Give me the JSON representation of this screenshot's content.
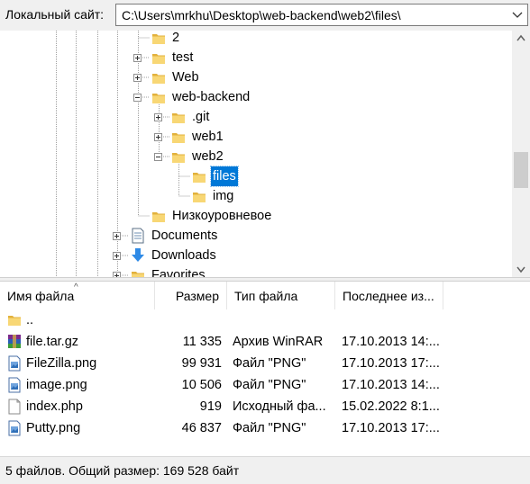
{
  "path_bar": {
    "label": "Локальный сайт:",
    "path": "C:\\Users\\mrkhu\\Desktop\\web-backend\\web2\\files\\"
  },
  "tree": {
    "nodes": [
      {
        "label": "2",
        "icon": "folder-icon",
        "expander": "none"
      },
      {
        "label": "test",
        "icon": "folder-icon",
        "expander": "plus"
      },
      {
        "label": "Web",
        "icon": "folder-icon",
        "expander": "plus"
      },
      {
        "label": "web-backend",
        "icon": "folder-icon",
        "expander": "minus"
      },
      {
        "label": ".git",
        "icon": "folder-icon",
        "expander": "plus"
      },
      {
        "label": "web1",
        "icon": "folder-icon",
        "expander": "plus"
      },
      {
        "label": "web2",
        "icon": "folder-icon",
        "expander": "minus"
      },
      {
        "label": "files",
        "icon": "folder-icon",
        "expander": "none",
        "selected": true
      },
      {
        "label": "img",
        "icon": "folder-icon",
        "expander": "none"
      },
      {
        "label": "Низкоуровневое",
        "icon": "folder-icon",
        "expander": "none"
      },
      {
        "label": "Documents",
        "icon": "document-icon",
        "expander": "plus"
      },
      {
        "label": "Downloads",
        "icon": "download-arrow-icon",
        "expander": "plus"
      },
      {
        "label": "Favorites",
        "icon": "folder-icon",
        "expander": "plus"
      }
    ]
  },
  "file_list": {
    "columns": {
      "name": "Имя файла",
      "size": "Размер",
      "type": "Тип файла",
      "modified": "Последнее из..."
    },
    "rows": [
      {
        "name": "..",
        "size": "",
        "type": "",
        "modified": "",
        "icon": "folder-icon"
      },
      {
        "name": "file.tar.gz",
        "size": "11 335",
        "type": "Архив WinRAR",
        "modified": "17.10.2013 14:...",
        "icon": "winrar-archive-icon"
      },
      {
        "name": "FileZilla.png",
        "size": "99 931",
        "type": "Файл \"PNG\"",
        "modified": "17.10.2013 17:...",
        "icon": "image-file-icon"
      },
      {
        "name": "image.png",
        "size": "10 506",
        "type": "Файл \"PNG\"",
        "modified": "17.10.2013 14:...",
        "icon": "image-file-icon"
      },
      {
        "name": "index.php",
        "size": "919",
        "type": "Исходный фа...",
        "modified": "15.02.2022 8:1...",
        "icon": "text-file-icon"
      },
      {
        "name": "Putty.png",
        "size": "46 837",
        "type": "Файл \"PNG\"",
        "modified": "17.10.2013 17:...",
        "icon": "image-file-icon"
      }
    ]
  },
  "status": "5 файлов. Общий размер: 169 528 байт",
  "colors": {
    "selection": "#0078d7",
    "folder": "#f8d775",
    "folder_dark": "#e2b13c",
    "download_arrow": "#2e8ae6",
    "chrome_bg": "#f0f0f0"
  }
}
